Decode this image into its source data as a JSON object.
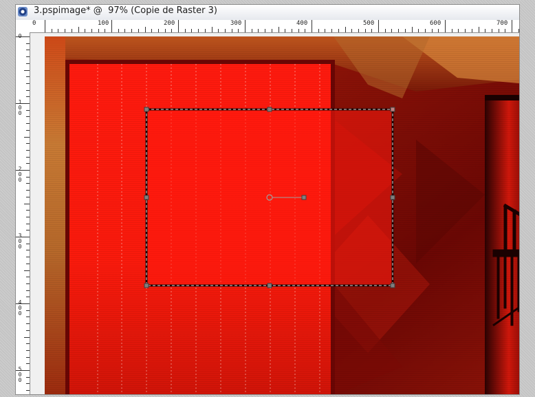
{
  "window": {
    "title": "3.pspimage* @  97% (Copie de Raster 3)",
    "title_icon": "psp-document-icon"
  },
  "rulers": {
    "horizontal_labels": [
      "0",
      "100",
      "200",
      "300",
      "400",
      "500",
      "600",
      "700"
    ],
    "vertical_labels": [
      "0",
      "100",
      "200",
      "300",
      "400",
      "500"
    ]
  },
  "colors": {
    "main_red": "#ff1a0e",
    "dark_red": "#7a0805",
    "deep_red": "#b41109",
    "orange_brown": "#c96a2a",
    "selection_handle": "#808080"
  },
  "tool": {
    "name": "pick-tool",
    "handles": 8,
    "has_rotation_handle": true
  }
}
